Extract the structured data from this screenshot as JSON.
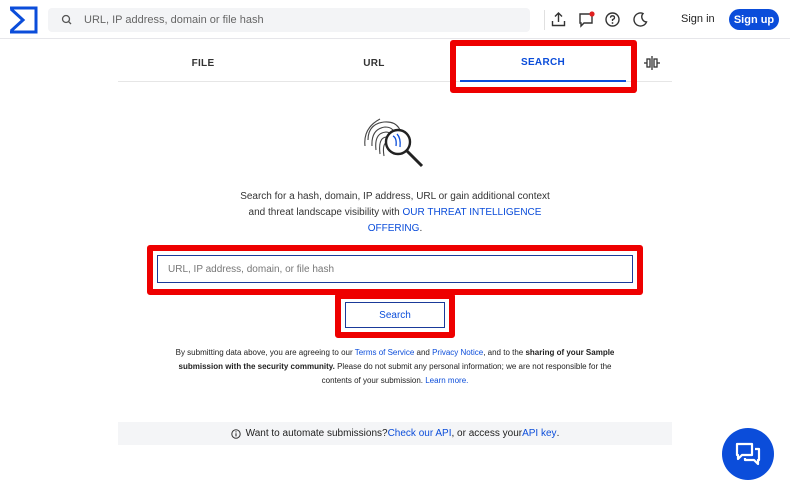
{
  "header": {
    "search_placeholder": "URL, IP address, domain or file hash",
    "sign_in": "Sign in",
    "sign_up": "Sign up",
    "icons": [
      "upload-icon",
      "notifications-icon",
      "help-icon",
      "dark-mode-icon"
    ],
    "brand_color": "#0b4dda",
    "notification_badge_color": "#e02020"
  },
  "tabs": [
    {
      "label": "FILE",
      "active": false
    },
    {
      "label": "URL",
      "active": false
    },
    {
      "label": "SEARCH",
      "active": true
    }
  ],
  "description": {
    "line1": "Search for a hash, domain, IP address, URL or gain additional context",
    "line2_prefix": "and threat landscape visibility with ",
    "link": "OUR THREAT INTELLIGENCE",
    "link_cont": "OFFERING",
    "suffix": "."
  },
  "search": {
    "placeholder": "URL, IP address, domain, or file hash",
    "button": "Search"
  },
  "legal": {
    "t1": "By submitting data above, you are agreeing to our ",
    "terms": "Terms of Service",
    "and": " and ",
    "privacy": "Privacy Notice",
    "t2": ", and to the ",
    "bold": "sharing of your Sample submission with the security community.",
    "t3": " Please do not submit any personal information; we are not responsible for the contents of your submission. ",
    "learn": "Learn more."
  },
  "api": {
    "info_icon": "info-icon",
    "t1": "Want to automate submissions? ",
    "link1": "Check our API",
    "t2": ", or access your ",
    "link2": "API key",
    "t3": "."
  },
  "highlight_color": "#ee0000"
}
